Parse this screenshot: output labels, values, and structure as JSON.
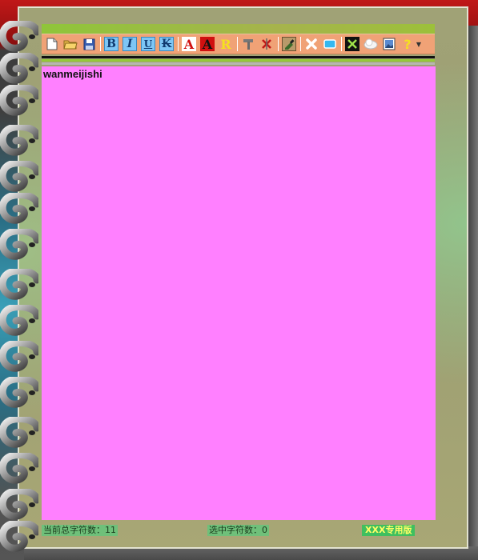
{
  "toolbar": {
    "buttons": [
      {
        "name": "new-document-icon",
        "glyph": ""
      },
      {
        "name": "open-folder-icon",
        "glyph": ""
      },
      {
        "name": "save-icon",
        "glyph": ""
      },
      {
        "name": "bold-button",
        "glyph": "B"
      },
      {
        "name": "italic-button",
        "glyph": "I"
      },
      {
        "name": "underline-button",
        "glyph": "U"
      },
      {
        "name": "strikethrough-button",
        "glyph": "K"
      },
      {
        "name": "font-color-button",
        "glyph": "A"
      },
      {
        "name": "background-color-button",
        "glyph": "A"
      },
      {
        "name": "highlight-button",
        "glyph": "R"
      },
      {
        "name": "hammer-icon",
        "glyph": ""
      },
      {
        "name": "delete-icon",
        "glyph": ""
      },
      {
        "name": "edit-tool-icon",
        "glyph": ""
      },
      {
        "name": "close-icon",
        "glyph": ""
      },
      {
        "name": "window-icon",
        "glyph": ""
      },
      {
        "name": "tools-icon",
        "glyph": ""
      },
      {
        "name": "cloud-icon",
        "glyph": ""
      },
      {
        "name": "picture-icon",
        "glyph": ""
      },
      {
        "name": "help-icon",
        "glyph": "?"
      }
    ]
  },
  "editor": {
    "content": "wanmeijishi"
  },
  "status": {
    "total_chars": "当前总字符数：11",
    "selected_chars": "选中字符数：0",
    "brand": "XXX专用版"
  }
}
